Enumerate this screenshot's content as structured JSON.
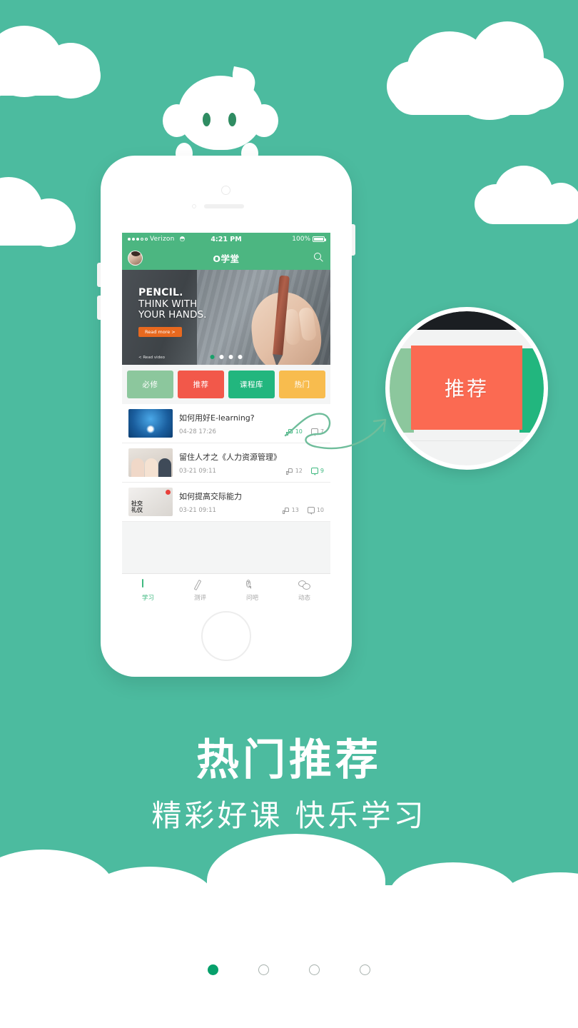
{
  "background_color": "#4cbb9f",
  "accent_green": "#4cb681",
  "accent_coral": "#fb6a52",
  "phone": {
    "status_bar": {
      "carrier": "Verizon",
      "signal_icon": "signal-dots-icon",
      "wifi_icon": "wifi-icon",
      "time": "4:21 PM",
      "battery_percent": "100%",
      "battery_icon": "battery-full-icon"
    },
    "nav_bar": {
      "avatar_icon": "user-avatar",
      "title": "O学堂",
      "search_icon": "search-icon"
    },
    "banner": {
      "line1": "PENCIL.",
      "line2": "THINK WITH",
      "line3": "YOUR HANDS.",
      "cta_label": "Read more >",
      "footer_label": "< Read video",
      "dots_total": 4,
      "dot_active_index": 0
    },
    "categories": [
      {
        "label": "必修",
        "color": "#8cc79d",
        "name": "category-required"
      },
      {
        "label": "推荐",
        "color": "#f2584a",
        "name": "category-recommended"
      },
      {
        "label": "课程库",
        "color": "#22b67e",
        "name": "category-library"
      },
      {
        "label": "热门",
        "color": "#f8bc4e",
        "name": "category-hot"
      }
    ],
    "list": [
      {
        "title": "如何用好E-learning?",
        "time": "04-28 17:26",
        "likes": "10",
        "comments": "7",
        "thumb": "elearning-thumbnail",
        "highlight": false
      },
      {
        "title": "留住人才之《人力资源管理》",
        "time": "03-21 09:11",
        "likes": "12",
        "comments": "9",
        "thumb": "hr-team-thumbnail",
        "highlight": true
      },
      {
        "title": "如何提高交际能力",
        "time": "03-21 09:11",
        "likes": "13",
        "comments": "10",
        "thumb": "social-etiquette-thumbnail",
        "thumb_text_1": "社交",
        "thumb_text_2": "礼仪",
        "highlight": false,
        "badge": true
      }
    ],
    "tabbar": [
      {
        "label": "学习",
        "icon": "book-icon",
        "active": true
      },
      {
        "label": "测评",
        "icon": "pencil-icon",
        "active": false
      },
      {
        "label": "问吧",
        "icon": "question-bubble-icon",
        "active": false
      },
      {
        "label": "动态",
        "icon": "chat-bubbles-icon",
        "active": false
      }
    ]
  },
  "magnifier": {
    "button_label": "推荐",
    "button_color": "#fb6a52"
  },
  "headline": {
    "title": "热门推荐",
    "subtitle": "精彩好课 快乐学习"
  },
  "page_indicator": {
    "total": 4,
    "active_index": 0
  },
  "decorations": {
    "mascot": "mascot-character",
    "cloud_top_left": "cloud-icon",
    "cloud_top_right": "cloud-icon",
    "cloud_mid_left": "cloud-icon",
    "cloud_mid_right": "cloud-icon",
    "arrow": "curly-arrow-icon"
  }
}
